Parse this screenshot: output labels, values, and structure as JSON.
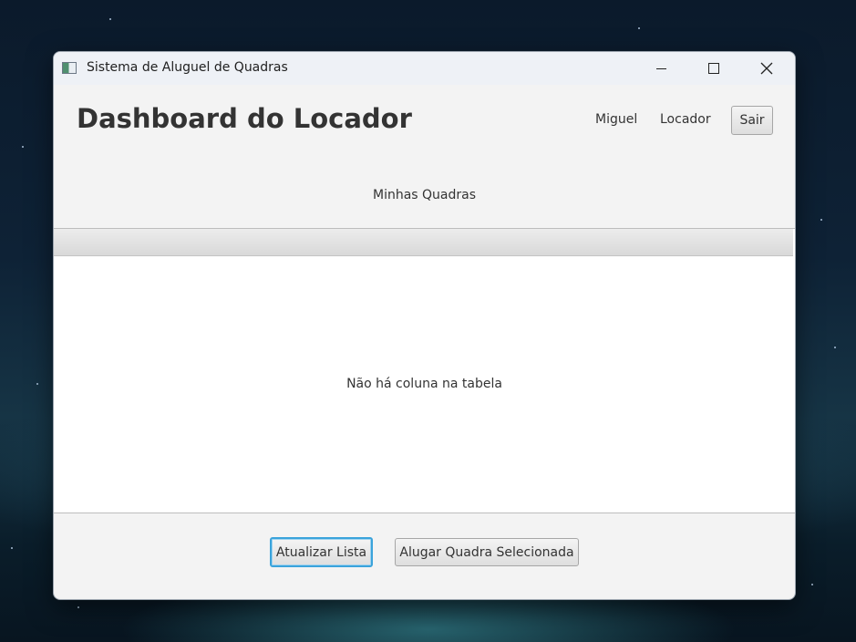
{
  "window": {
    "title": "Sistema de Aluguel de Quadras",
    "icon": "app-window-icon"
  },
  "header": {
    "title": "Dashboard do Locador",
    "user_name": "Miguel",
    "user_role": "Locador",
    "logout_label": "Sair"
  },
  "content": {
    "section_label": "Minhas Quadras",
    "table_empty_message": "Não há coluna na tabela"
  },
  "actions": {
    "refresh_label": "Atualizar Lista",
    "rent_label": "Alugar Quadra Selecionada"
  },
  "colors": {
    "focus_accent": "#3aa3db",
    "window_background": "#f3f3f3",
    "table_background": "#ffffff"
  }
}
